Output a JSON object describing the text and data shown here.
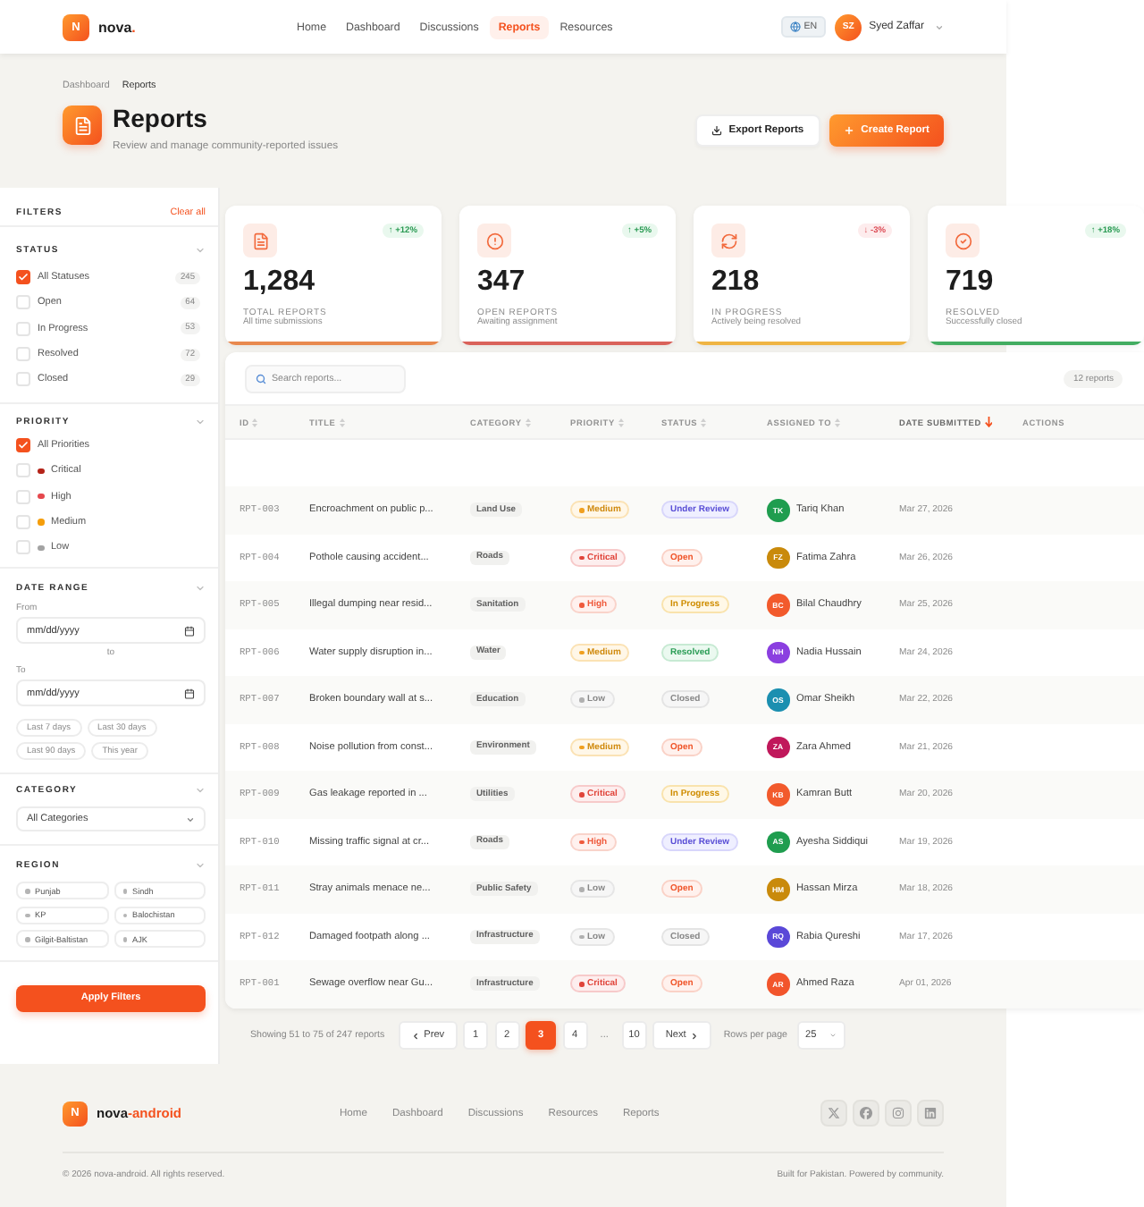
{
  "header": {
    "logo": {
      "letter": "N",
      "name": "nova",
      "suffix": "."
    },
    "nav": [
      {
        "label": "Home",
        "selected": false
      },
      {
        "label": "Dashboard",
        "selected": false
      },
      {
        "label": "Discussions",
        "selected": false
      },
      {
        "label": "Reports",
        "selected": true
      },
      {
        "label": "Resources",
        "selected": false
      }
    ],
    "language": "EN",
    "user": {
      "initials": "SZ",
      "name": "Syed Zaffar"
    }
  },
  "page": {
    "breadcrumb": [
      "Dashboard",
      "Reports"
    ],
    "title": "Reports",
    "subtitle": "Review and manage community-reported issues",
    "actions": [
      {
        "label": "Export Reports",
        "kind": "export"
      },
      {
        "label": "Create Report",
        "kind": "create"
      }
    ]
  },
  "filters": {
    "title": "FILTERS",
    "clear": "Clear all",
    "status": {
      "heading": "STATUS",
      "options": [
        {
          "label": "All Statuses",
          "count": "245",
          "checked": true
        },
        {
          "label": "Open",
          "count": "64",
          "checked": false
        },
        {
          "label": "In Progress",
          "count": "53",
          "checked": false
        },
        {
          "label": "Resolved",
          "count": "72",
          "checked": false
        },
        {
          "label": "Closed",
          "count": "29",
          "checked": false
        }
      ]
    },
    "priority": {
      "heading": "PRIORITY",
      "options": [
        {
          "label": "All Priorities",
          "checked": true
        },
        {
          "label": "Critical",
          "checked": false,
          "color": "#b42318"
        },
        {
          "label": "High",
          "checked": false,
          "color": "#e5484d"
        },
        {
          "label": "Medium",
          "checked": false,
          "color": "#f59e0b"
        },
        {
          "label": "Low",
          "checked": false,
          "color": "#a3a3a3"
        }
      ]
    },
    "date_range": {
      "heading": "DATE RANGE",
      "from": {
        "label": "From",
        "placeholder": "mm/dd/yyyy"
      },
      "separator": "to",
      "to": {
        "label": "To",
        "placeholder": "mm/dd/yyyy"
      },
      "presets": [
        "Last 7 days",
        "Last 30 days",
        "Last 90 days",
        "This year"
      ]
    },
    "category": {
      "heading": "CATEGORY",
      "value": "All Categories"
    },
    "region": {
      "heading": "REGION",
      "options": [
        "Punjab",
        "Sindh",
        "KP",
        "Balochistan",
        "Gilgit-Baltistan",
        "AJK"
      ]
    },
    "apply": "Apply Filters"
  },
  "stats": [
    {
      "kind": "total",
      "change": "↑ +12%",
      "increase": true,
      "value": "1,284",
      "label": "TOTAL REPORTS",
      "caption": "All time submissions",
      "color": "#e8894e"
    },
    {
      "kind": "open",
      "change": "↑ +5%",
      "increase": true,
      "value": "347",
      "label": "OPEN REPORTS",
      "caption": "Awaiting assignment",
      "color": "#d9625a"
    },
    {
      "kind": "progress",
      "change": "↓ -3%",
      "increase": false,
      "value": "218",
      "label": "IN PROGRESS",
      "caption": "Actively being resolved",
      "color": "#efb443"
    },
    {
      "kind": "resolved",
      "change": "↑ +18%",
      "increase": true,
      "value": "719",
      "label": "RESOLVED",
      "caption": "Successfully closed",
      "color": "#43ad62"
    }
  ],
  "table": {
    "search": {
      "placeholder": "Search reports..."
    },
    "count": "12 reports",
    "columns": [
      {
        "label": "ID",
        "sortable": true,
        "sorted": false
      },
      {
        "label": "TITLE",
        "sortable": true,
        "sorted": false
      },
      {
        "label": "CATEGORY",
        "sortable": true,
        "sorted": false
      },
      {
        "label": "PRIORITY",
        "sortable": true,
        "sorted": false
      },
      {
        "label": "STATUS",
        "sortable": true,
        "sorted": false
      },
      {
        "label": "ASSIGNED TO",
        "sortable": true,
        "sorted": false
      },
      {
        "label": "DATE SUBMITTED",
        "sortable": true,
        "sorted": true
      },
      {
        "label": "ACTIONS",
        "sortable": false,
        "sorted": false
      }
    ],
    "rows": [
      {
        "id": "RPT-003",
        "title": "Encroachment on public p...",
        "category": "Land Use",
        "priority": {
          "label": "Medium",
          "kind": "medium"
        },
        "status": {
          "label": "Under Review",
          "kind": "review"
        },
        "assignee": {
          "initials": "TK",
          "name": "Tariq Khan",
          "color": "#1f9d4f"
        },
        "date": "Mar 27, 2026"
      },
      {
        "id": "RPT-004",
        "title": "Pothole causing accident...",
        "category": "Roads",
        "priority": {
          "label": "Critical",
          "kind": "critical"
        },
        "status": {
          "label": "Open",
          "kind": "open"
        },
        "assignee": {
          "initials": "FZ",
          "name": "Fatima Zahra",
          "color": "#c98a0b"
        },
        "date": "Mar 26, 2026"
      },
      {
        "id": "RPT-005",
        "title": "Illegal dumping near resid...",
        "category": "Sanitation",
        "priority": {
          "label": "High",
          "kind": "high"
        },
        "status": {
          "label": "In Progress",
          "kind": "progress"
        },
        "assignee": {
          "initials": "BC",
          "name": "Bilal Chaudhry",
          "color": "#f25a2c"
        },
        "date": "Mar 25, 2026"
      },
      {
        "id": "RPT-006",
        "title": "Water supply disruption in...",
        "category": "Water",
        "priority": {
          "label": "Medium",
          "kind": "medium"
        },
        "status": {
          "label": "Resolved",
          "kind": "resolved"
        },
        "assignee": {
          "initials": "NH",
          "name": "Nadia Hussain",
          "color": "#8b3fe0"
        },
        "date": "Mar 24, 2026"
      },
      {
        "id": "RPT-007",
        "title": "Broken boundary wall at s...",
        "category": "Education",
        "priority": {
          "label": "Low",
          "kind": "low"
        },
        "status": {
          "label": "Closed",
          "kind": "closed"
        },
        "assignee": {
          "initials": "OS",
          "name": "Omar Sheikh",
          "color": "#1b8fb0"
        },
        "date": "Mar 22, 2026"
      },
      {
        "id": "RPT-008",
        "title": "Noise pollution from const...",
        "category": "Environment",
        "priority": {
          "label": "Medium",
          "kind": "medium"
        },
        "status": {
          "label": "Open",
          "kind": "open"
        },
        "assignee": {
          "initials": "ZA",
          "name": "Zara Ahmed",
          "color": "#c0185b"
        },
        "date": "Mar 21, 2026"
      },
      {
        "id": "RPT-009",
        "title": "Gas leakage reported in ...",
        "category": "Utilities",
        "priority": {
          "label": "Critical",
          "kind": "critical"
        },
        "status": {
          "label": "In Progress",
          "kind": "progress"
        },
        "assignee": {
          "initials": "KB",
          "name": "Kamran Butt",
          "color": "#f25a2c"
        },
        "date": "Mar 20, 2026"
      },
      {
        "id": "RPT-010",
        "title": "Missing traffic signal at cr...",
        "category": "Roads",
        "priority": {
          "label": "High",
          "kind": "high"
        },
        "status": {
          "label": "Under Review",
          "kind": "review"
        },
        "assignee": {
          "initials": "AS",
          "name": "Ayesha Siddiqui",
          "color": "#1f9d4f"
        },
        "date": "Mar 19, 2026"
      },
      {
        "id": "RPT-011",
        "title": "Stray animals menace ne...",
        "category": "Public Safety",
        "priority": {
          "label": "Low",
          "kind": "low"
        },
        "status": {
          "label": "Open",
          "kind": "open"
        },
        "assignee": {
          "initials": "HM",
          "name": "Hassan Mirza",
          "color": "#c98a0b"
        },
        "date": "Mar 18, 2026"
      },
      {
        "id": "RPT-012",
        "title": "Damaged footpath along ...",
        "category": "Infrastructure",
        "priority": {
          "label": "Low",
          "kind": "low"
        },
        "status": {
          "label": "Closed",
          "kind": "closed"
        },
        "assignee": {
          "initials": "RQ",
          "name": "Rabia Qureshi",
          "color": "#5a48d8"
        },
        "date": "Mar 17, 2026"
      },
      {
        "id": "RPT-001",
        "title": "Sewage overflow near Gu...",
        "category": "Infrastructure",
        "priority": {
          "label": "Critical",
          "kind": "critical"
        },
        "status": {
          "label": "Open",
          "kind": "open"
        },
        "assignee": {
          "initials": "AR",
          "name": "Ahmed Raza",
          "color": "#f2552c"
        },
        "date": "Apr 01, 2026"
      }
    ]
  },
  "pagination": {
    "summary": "Showing 51 to 75 of 247 reports",
    "prev": "Prev",
    "pages": [
      {
        "label": "1",
        "kind": "page",
        "selected": false
      },
      {
        "label": "2",
        "kind": "page",
        "selected": false
      },
      {
        "label": "3",
        "kind": "page",
        "selected": true
      },
      {
        "label": "4",
        "kind": "page",
        "selected": false
      },
      {
        "label": "...",
        "kind": "gap"
      },
      {
        "label": "10",
        "kind": "page",
        "selected": false
      }
    ],
    "next": "Next",
    "rows_label": "Rows per page",
    "rows_value": "25"
  },
  "footer": {
    "logo": {
      "letter": "N",
      "name": "nova",
      "suffix": "-android"
    },
    "links": [
      "Home",
      "Dashboard",
      "Discussions",
      "Resources",
      "Reports"
    ],
    "copyright": "© 2026 nova-android. All rights reserved.",
    "tagline": "Built for Pakistan. Powered by community."
  }
}
